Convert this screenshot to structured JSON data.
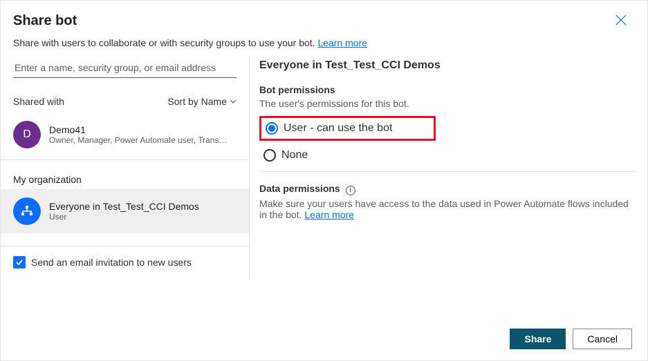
{
  "header": {
    "title": "Share bot",
    "subtitle_prefix": "Share with users to collaborate or with security groups to use your bot. ",
    "learn_more": "Learn more"
  },
  "input": {
    "placeholder": "Enter a name, security group, or email address"
  },
  "shared": {
    "label": "Shared with",
    "sort_label": "Sort by Name",
    "members": [
      {
        "initial": "D",
        "name": "Demo41",
        "roles": "Owner, Manager, Power Automate user, Transc..."
      }
    ]
  },
  "org": {
    "section_label": "My organization",
    "items": [
      {
        "name": "Everyone in Test_Test_CCI Demos",
        "role": "User"
      }
    ]
  },
  "footer_left": {
    "checkbox_label": "Send an email invitation to new users"
  },
  "details": {
    "title": "Everyone in Test_Test_CCI Demos",
    "bot_perm_title": "Bot permissions",
    "bot_perm_desc": "The user's permissions for this bot.",
    "radio_selected": "User - can use the bot",
    "radio_none": "None",
    "data_perm_title": "Data permissions",
    "data_perm_desc_prefix": "Make sure your users have access to the data used in Power Automate flows included in the bot. ",
    "data_perm_learn_more": "Learn more"
  },
  "buttons": {
    "share": "Share",
    "cancel": "Cancel"
  }
}
